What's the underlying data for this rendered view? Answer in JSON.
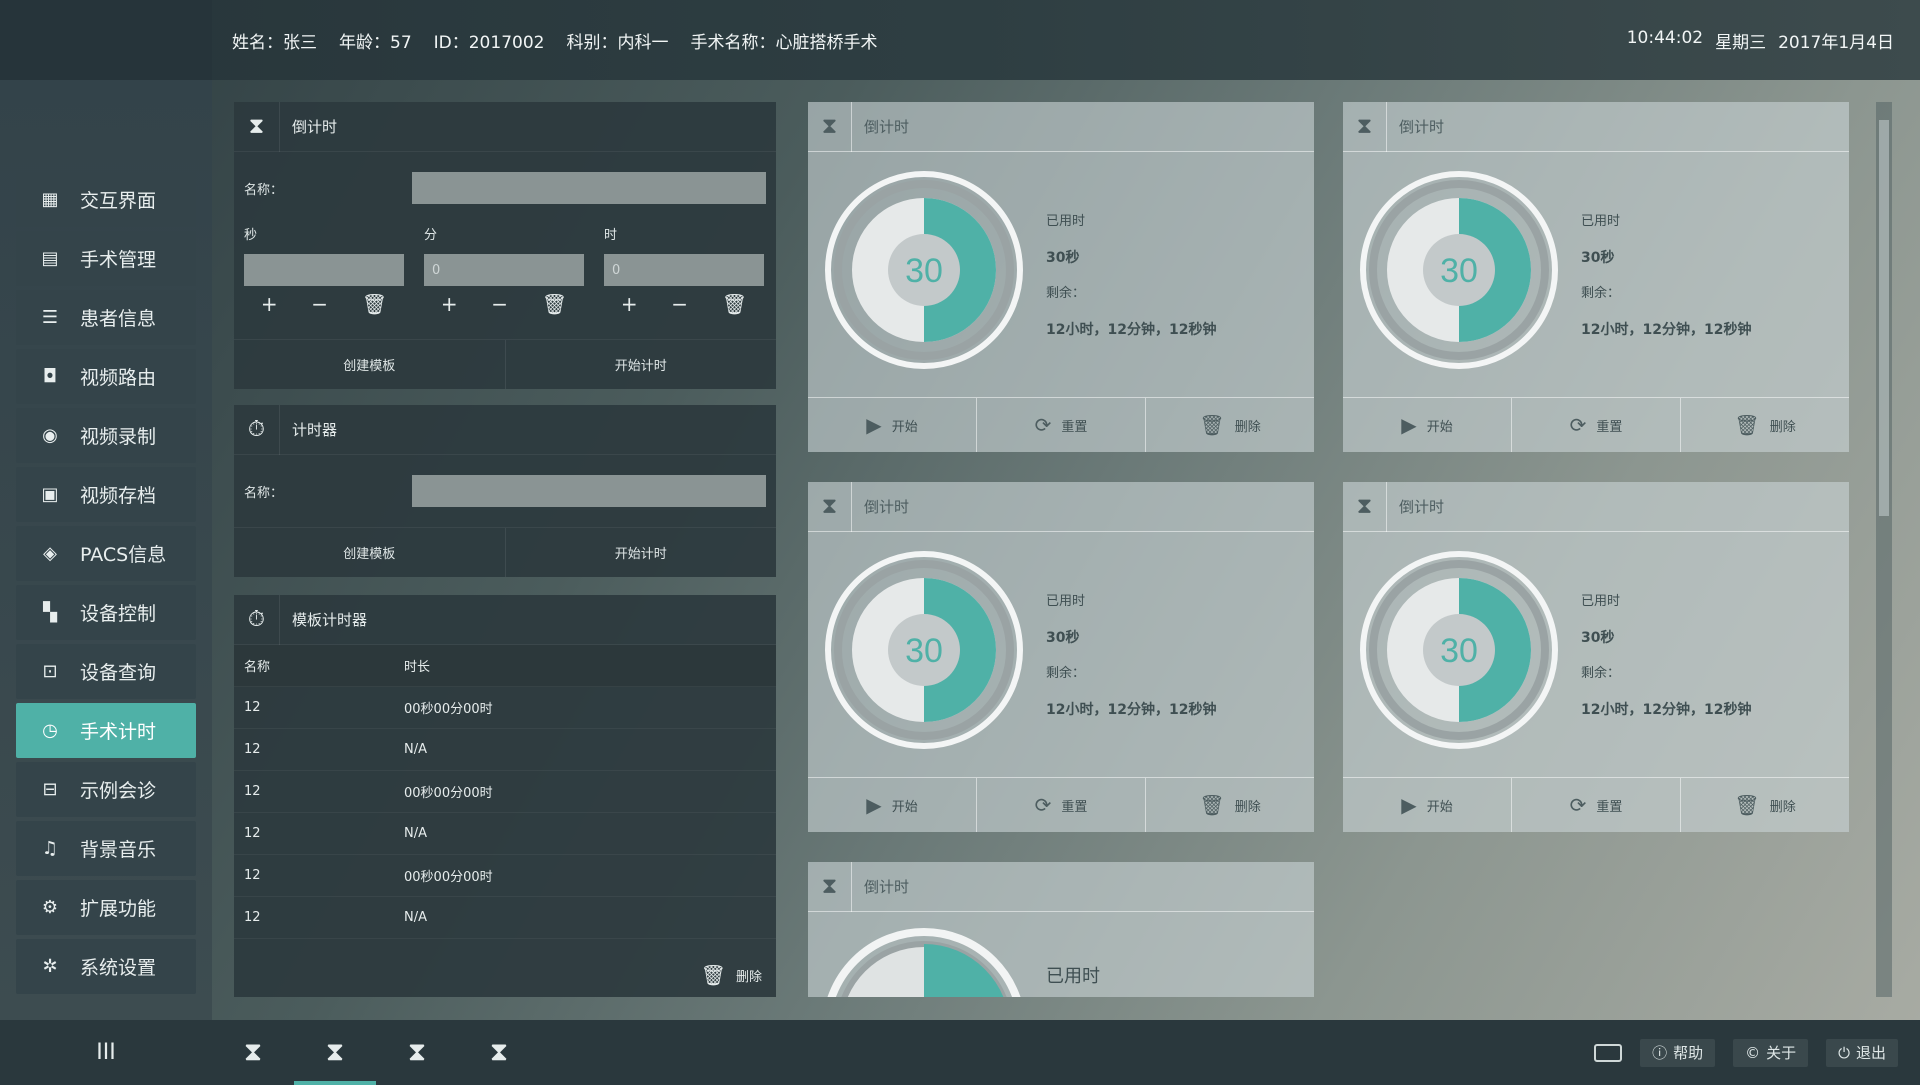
{
  "header": {
    "patient_name": "姓名：张三",
    "age": "年龄：57",
    "id": "ID：2017002",
    "department": "科别：内科一",
    "surgery": "手术名称：心脏搭桥手术",
    "time": "10:44:02",
    "weekday": "星期三",
    "date": "2017年1月4日"
  },
  "sidebar": {
    "items": [
      {
        "label": "交互界面",
        "icon": "interactive-icon",
        "glyph": "▦"
      },
      {
        "label": "手术管理",
        "icon": "calendar-icon",
        "glyph": "▤"
      },
      {
        "label": "患者信息",
        "icon": "list-icon",
        "glyph": "☰"
      },
      {
        "label": "视频路由",
        "icon": "video-camera-icon",
        "glyph": "◘"
      },
      {
        "label": "视频录制",
        "icon": "record-icon",
        "glyph": "◉"
      },
      {
        "label": "视频存档",
        "icon": "archive-icon",
        "glyph": "▣"
      },
      {
        "label": "PACS信息",
        "icon": "layers-icon",
        "glyph": "◈"
      },
      {
        "label": "设备控制",
        "icon": "dashboard-icon",
        "glyph": "▚"
      },
      {
        "label": "设备查询",
        "icon": "search-doc-icon",
        "glyph": "⊡"
      },
      {
        "label": "手术计时",
        "icon": "timer-icon",
        "glyph": "◷"
      },
      {
        "label": "示例会诊",
        "icon": "consult-icon",
        "glyph": "⊟"
      },
      {
        "label": "背景音乐",
        "icon": "music-icon",
        "glyph": "♫"
      },
      {
        "label": "扩展功能",
        "icon": "gears-icon",
        "glyph": "⚙"
      },
      {
        "label": "系统设置",
        "icon": "settings-icon",
        "glyph": "✲"
      }
    ],
    "active_index": 9
  },
  "countdown_panel": {
    "title": "倒计时",
    "name_label": "名称：",
    "sec_label": "秒",
    "min_label": "分",
    "hour_label": "时",
    "min_value": "0",
    "hour_value": "0",
    "create_label": "创建模板",
    "start_label": "开始计时"
  },
  "timer_panel": {
    "title": "计时器",
    "name_label": "名称：",
    "create_label": "创建模板",
    "start_label": "开始计时"
  },
  "template_panel": {
    "title": "模板计时器",
    "col_name": "名称",
    "col_duration": "时长",
    "rows": [
      {
        "name": "12",
        "duration": "00秒00分00时"
      },
      {
        "name": "12",
        "duration": "N/A"
      },
      {
        "name": "12",
        "duration": "00秒00分00时"
      },
      {
        "name": "12",
        "duration": "N/A"
      },
      {
        "name": "12",
        "duration": "00秒00分00时"
      },
      {
        "name": "12",
        "duration": "N/A"
      }
    ],
    "delete_label": "删除"
  },
  "cards": [
    {
      "title": "倒计时",
      "value": "30",
      "used_label": "已用时",
      "used": "30秒",
      "remain_label": "剩余：",
      "remain": "12小时，12分钟，12秒钟",
      "start": "开始",
      "reset": "重置",
      "delete": "删除",
      "progress": 0.5
    },
    {
      "title": "倒计时",
      "value": "30",
      "used_label": "已用时",
      "used": "30秒",
      "remain_label": "剩余：",
      "remain": "12小时，12分钟，12秒钟",
      "start": "开始",
      "reset": "重置",
      "delete": "删除",
      "progress": 0.5
    },
    {
      "title": "倒计时",
      "value": "30",
      "used_label": "已用时",
      "used": "30秒",
      "remain_label": "剩余：",
      "remain": "12小时，12分钟，12秒钟",
      "start": "开始",
      "reset": "重置",
      "delete": "删除",
      "progress": 0.5
    },
    {
      "title": "倒计时",
      "value": "30",
      "used_label": "已用时",
      "used": "30秒",
      "remain_label": "剩余：",
      "remain": "12小时，12分钟，12秒钟",
      "start": "开始",
      "reset": "重置",
      "delete": "删除",
      "progress": 0.5
    }
  ],
  "partial_card": {
    "title": "倒计时",
    "used_label": "已用时"
  },
  "bottombar": {
    "menu_glyph": "III",
    "tabs": [
      "⧗",
      "⧗",
      "⧗",
      "⧗"
    ],
    "active_tab": 1,
    "help": "帮助",
    "about": "关于",
    "exit": "退出"
  },
  "colors": {
    "accent": "#4fb1a7"
  }
}
